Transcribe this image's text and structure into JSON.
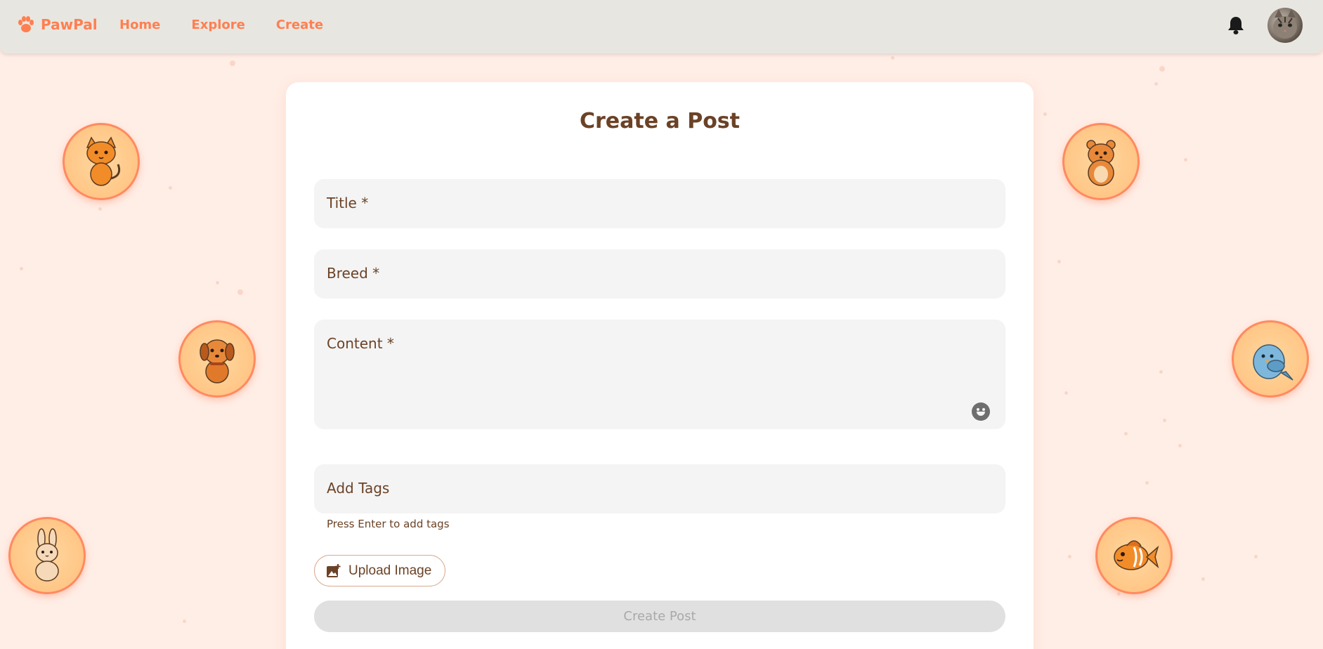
{
  "nav": {
    "brand": "PawPal",
    "links": [
      {
        "label": "Home"
      },
      {
        "label": "Explore"
      },
      {
        "label": "Create"
      }
    ]
  },
  "form": {
    "title": "Create a Post",
    "fields": {
      "title_label": "Title *",
      "breed_label": "Breed *",
      "content_label": "Content *",
      "tags_label": "Add Tags"
    },
    "tags_hint": "Press Enter to add tags",
    "upload_label": "Upload Image",
    "submit_label": "Create Post"
  },
  "icons": [
    "paw-icon",
    "bell-icon",
    "emoji-icon",
    "image-add-icon"
  ],
  "colors": {
    "accent": "#ff7f50",
    "background": "#ffeee6",
    "topbar": "#e8e6e1",
    "text": "#6b4226",
    "disabled": "#e0e0e0"
  }
}
